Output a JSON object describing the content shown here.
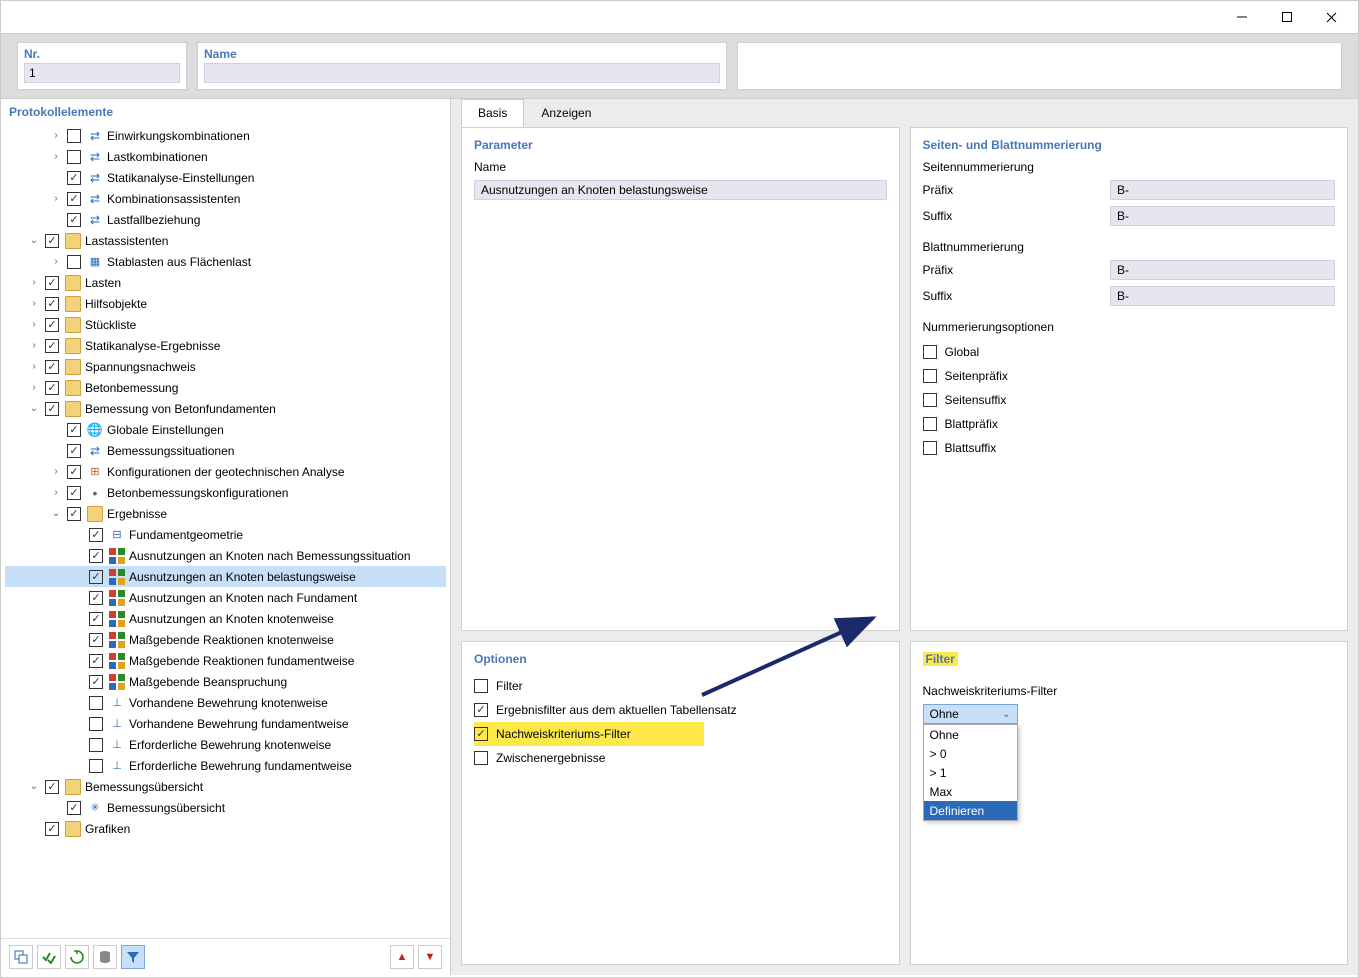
{
  "window": {
    "minimize": "–",
    "maximize": "☐",
    "close": "✕"
  },
  "header": {
    "nr_label": "Nr.",
    "nr_value": "1",
    "name_label": "Name",
    "name_value": ""
  },
  "left": {
    "title": "Protokollelemente",
    "footer_icons": [
      "copy",
      "check-all",
      "sync",
      "db",
      "filter",
      "up",
      "down"
    ]
  },
  "tree": [
    {
      "depth": 1,
      "toggle": ">",
      "checked": false,
      "icon": "blue",
      "glyph": "⇄",
      "label": "Einwirkungskombinationen"
    },
    {
      "depth": 1,
      "toggle": ">",
      "checked": false,
      "icon": "blue",
      "glyph": "⇄",
      "label": "Lastkombinationen"
    },
    {
      "depth": 1,
      "toggle": "",
      "checked": true,
      "icon": "blue",
      "glyph": "⇄",
      "label": "Statikanalyse-Einstellungen"
    },
    {
      "depth": 1,
      "toggle": ">",
      "checked": true,
      "icon": "blue",
      "glyph": "⇄",
      "label": "Kombinationsassistenten"
    },
    {
      "depth": 1,
      "toggle": "",
      "checked": true,
      "icon": "blue",
      "glyph": "⇄",
      "label": "Lastfallbeziehung"
    },
    {
      "depth": 0,
      "toggle": "v",
      "checked": true,
      "icon": "folder",
      "label": "Lastassistenten"
    },
    {
      "depth": 1,
      "toggle": ">",
      "checked": false,
      "icon": "struct",
      "glyph": "▦",
      "label": "Stablasten aus Flächenlast"
    },
    {
      "depth": 0,
      "toggle": ">",
      "checked": true,
      "icon": "folder",
      "label": "Lasten"
    },
    {
      "depth": 0,
      "toggle": ">",
      "checked": true,
      "icon": "folder",
      "label": "Hilfsobjekte"
    },
    {
      "depth": 0,
      "toggle": ">",
      "checked": true,
      "icon": "folder",
      "label": "Stückliste"
    },
    {
      "depth": 0,
      "toggle": ">",
      "checked": true,
      "icon": "folder",
      "label": "Statikanalyse-Ergebnisse"
    },
    {
      "depth": 0,
      "toggle": ">",
      "checked": true,
      "icon": "folder",
      "label": "Spannungsnachweis"
    },
    {
      "depth": 0,
      "toggle": ">",
      "checked": true,
      "icon": "folder",
      "label": "Betonbemessung"
    },
    {
      "depth": 0,
      "toggle": "v",
      "checked": true,
      "icon": "folder",
      "label": "Bemessung von Betonfundamenten"
    },
    {
      "depth": 1,
      "toggle": "",
      "checked": true,
      "icon": "globe",
      "glyph": "🌐",
      "label": "Globale Einstellungen"
    },
    {
      "depth": 1,
      "toggle": "",
      "checked": true,
      "icon": "blue",
      "glyph": "⇄",
      "label": "Bemessungssituationen"
    },
    {
      "depth": 1,
      "toggle": ">",
      "checked": true,
      "icon": "stack",
      "glyph": "⊞",
      "label": "Konfigurationen der geotechnischen Analyse"
    },
    {
      "depth": 1,
      "toggle": ">",
      "checked": true,
      "icon": "dot",
      "glyph": "•",
      "label": "Betonbemessungskonfigurationen"
    },
    {
      "depth": 1,
      "toggle": "v",
      "checked": true,
      "icon": "folder",
      "label": "Ergebnisse"
    },
    {
      "depth": 2,
      "toggle": "",
      "checked": true,
      "icon": "struct",
      "glyph": "⊟",
      "label": "Fundamentgeometrie"
    },
    {
      "depth": 2,
      "toggle": "",
      "checked": true,
      "icon": "multi",
      "label": "Ausnutzungen an Knoten nach Bemessungssituation"
    },
    {
      "depth": 2,
      "toggle": "",
      "checked": true,
      "icon": "multi",
      "label": "Ausnutzungen an Knoten belastungsweise",
      "selected": true
    },
    {
      "depth": 2,
      "toggle": "",
      "checked": true,
      "icon": "multi",
      "label": "Ausnutzungen an Knoten nach Fundament"
    },
    {
      "depth": 2,
      "toggle": "",
      "checked": true,
      "icon": "multi",
      "label": "Ausnutzungen an Knoten knotenweise"
    },
    {
      "depth": 2,
      "toggle": "",
      "checked": true,
      "icon": "multi",
      "label": "Maßgebende Reaktionen knotenweise"
    },
    {
      "depth": 2,
      "toggle": "",
      "checked": true,
      "icon": "multi",
      "label": "Maßgebende Reaktionen fundamentweise"
    },
    {
      "depth": 2,
      "toggle": "",
      "checked": true,
      "icon": "multi",
      "label": "Maßgebende Beanspruchung"
    },
    {
      "depth": 2,
      "toggle": "",
      "checked": false,
      "icon": "struct",
      "glyph": "⊥",
      "label": "Vorhandene Bewehrung knotenweise"
    },
    {
      "depth": 2,
      "toggle": "",
      "checked": false,
      "icon": "struct",
      "glyph": "⊥",
      "label": "Vorhandene Bewehrung fundamentweise"
    },
    {
      "depth": 2,
      "toggle": "",
      "checked": false,
      "icon": "struct",
      "glyph": "⊥",
      "label": "Erforderliche Bewehrung knotenweise"
    },
    {
      "depth": 2,
      "toggle": "",
      "checked": false,
      "icon": "struct",
      "glyph": "⊥",
      "label": "Erforderliche Bewehrung fundamentweise"
    },
    {
      "depth": 0,
      "toggle": "v",
      "checked": true,
      "icon": "folder",
      "label": "Bemessungsübersicht"
    },
    {
      "depth": 1,
      "toggle": "",
      "checked": true,
      "icon": "struct",
      "glyph": "✳",
      "label": "Bemessungsübersicht"
    },
    {
      "depth": 0,
      "toggle": "",
      "checked": true,
      "icon": "folder",
      "label": "Grafiken"
    }
  ],
  "tabs": {
    "basis": "Basis",
    "anzeigen": "Anzeigen"
  },
  "parameter": {
    "title": "Parameter",
    "name_label": "Name",
    "name_value": "Ausnutzungen an Knoten belastungsweise"
  },
  "numbering": {
    "title": "Seiten- und Blattnummerierung",
    "page_title": "Seitennummerierung",
    "page_prefix_label": "Präfix",
    "page_prefix_value": "B-",
    "page_suffix_label": "Suffix",
    "page_suffix_value": "B-",
    "sheet_title": "Blattnummerierung",
    "sheet_prefix_label": "Präfix",
    "sheet_prefix_value": "B-",
    "sheet_suffix_label": "Suffix",
    "sheet_suffix_value": "B-",
    "opt_title": "Nummerierungsoptionen",
    "opts": [
      "Global",
      "Seitenpräfix",
      "Seitensuffix",
      "Blattpräfix",
      "Blattsuffix"
    ]
  },
  "optionen": {
    "title": "Optionen",
    "items": [
      {
        "checked": false,
        "label": "Filter"
      },
      {
        "checked": true,
        "label": "Ergebnisfilter aus dem aktuellen Tabellensatz"
      },
      {
        "checked": true,
        "label": "Nachweiskriteriums-Filter",
        "highlight": true
      },
      {
        "checked": false,
        "label": "Zwischenergebnisse"
      }
    ]
  },
  "filter": {
    "title": "Filter",
    "label": "Nachweiskriteriums-Filter",
    "selected": "Ohne",
    "options": [
      "Ohne",
      "> 0",
      "> 1",
      "Max",
      "Definieren"
    ],
    "highlighted_index": 4
  }
}
